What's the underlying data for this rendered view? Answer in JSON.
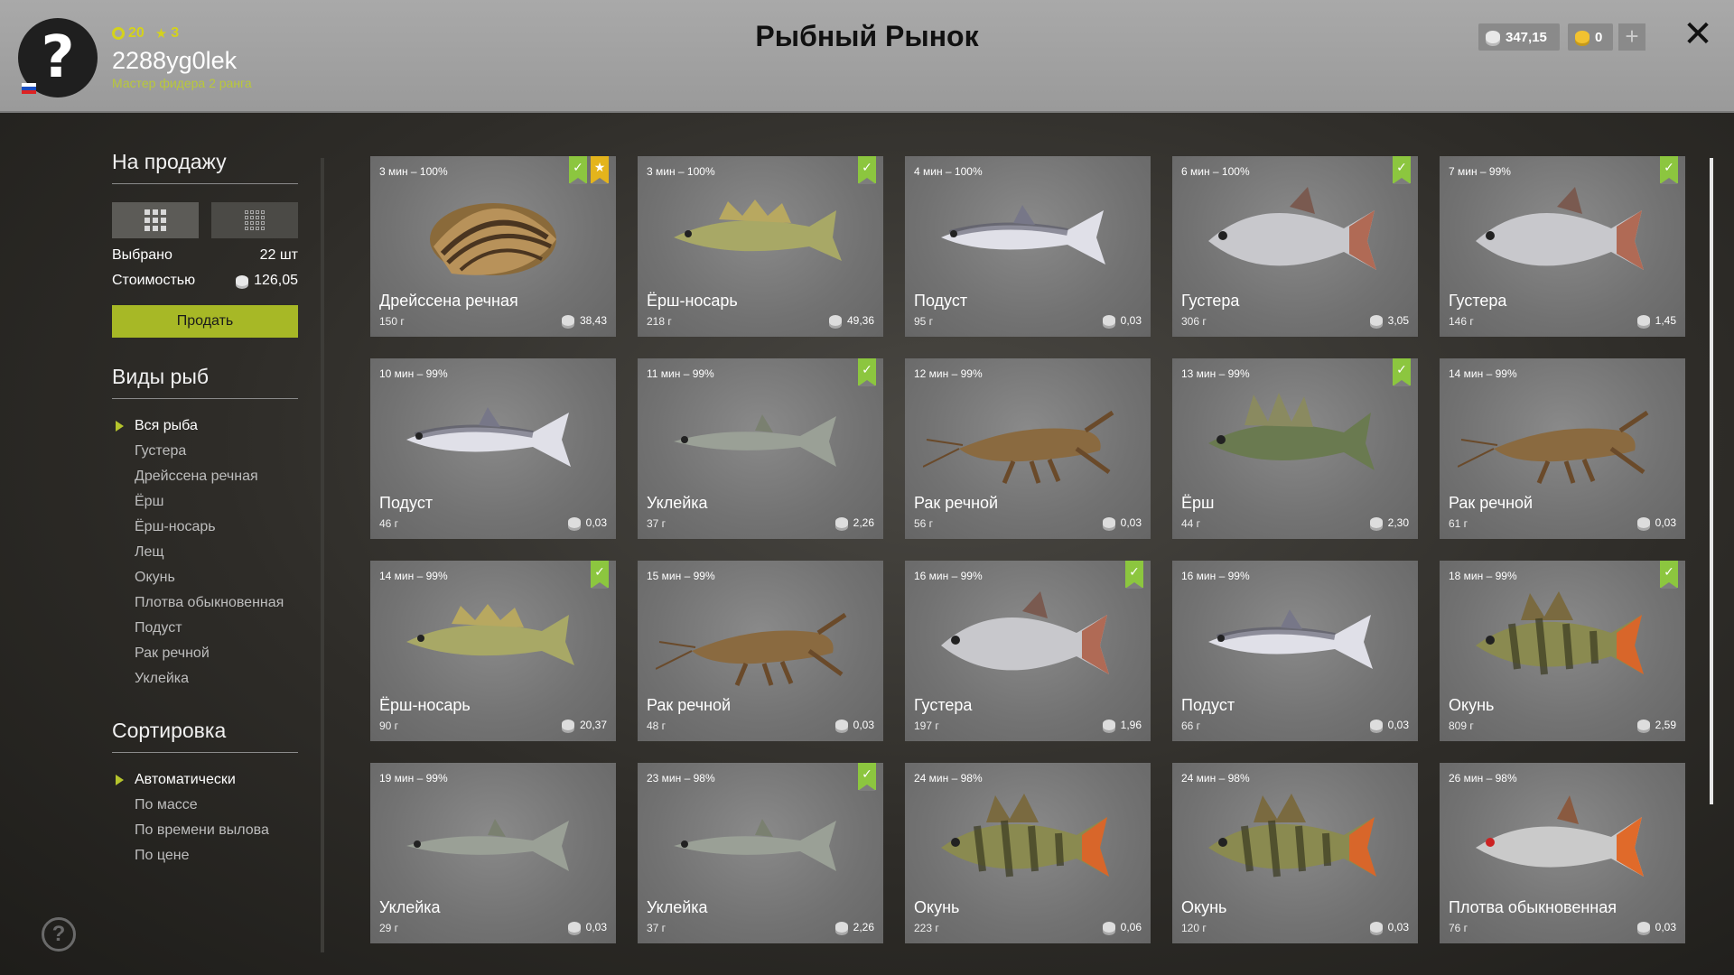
{
  "header": {
    "title": "Рыбный Рынок",
    "avatar_glyph": "?",
    "user": {
      "coins_small": "20",
      "stars": "3",
      "name": "2288yg0lek",
      "rank": "Мастер фидера 2 ранга"
    },
    "silver": "347,15",
    "gold": "0",
    "plus": "+",
    "close": "✕"
  },
  "sidebar": {
    "sale_title": "На продажу",
    "selected_label": "Выбрано",
    "selected_value": "22 шт",
    "cost_label": "Стоимостью",
    "cost_value": "126,05",
    "sell_button": "Продать",
    "species_title": "Виды рыб",
    "species": [
      "Вся рыба",
      "Густера",
      "Дрейссена речная",
      "Ёрш",
      "Ёрш-носарь",
      "Лещ",
      "Окунь",
      "Плотва обыкновенная",
      "Подуст",
      "Рак речной",
      "Уклейка"
    ],
    "sort_title": "Сортировка",
    "sort": [
      "Автоматически",
      "По массе",
      "По времени вылова",
      "По цене"
    ],
    "help": "?"
  },
  "cards": [
    {
      "time": "3 мин – 100%",
      "name": "Дрейссена речная",
      "weight": "150 г",
      "price": "38,43",
      "kind": "mussel",
      "check": true,
      "star": true
    },
    {
      "time": "3 мин – 100%",
      "name": "Ёрш-носарь",
      "weight": "218 г",
      "price": "49,36",
      "kind": "ruffe2",
      "check": true,
      "star": false
    },
    {
      "time": "4 мин – 100%",
      "name": "Подуст",
      "weight": "95 г",
      "price": "0,03",
      "kind": "podust",
      "check": false,
      "star": false
    },
    {
      "time": "6 мин – 100%",
      "name": "Густера",
      "weight": "306 г",
      "price": "3,05",
      "kind": "bream",
      "check": true,
      "star": false
    },
    {
      "time": "7 мин – 99%",
      "name": "Густера",
      "weight": "146 г",
      "price": "1,45",
      "kind": "bream",
      "check": true,
      "star": false
    },
    {
      "time": "10 мин – 99%",
      "name": "Подуст",
      "weight": "46 г",
      "price": "0,03",
      "kind": "podust",
      "check": false,
      "star": false
    },
    {
      "time": "11 мин – 99%",
      "name": "Уклейка",
      "weight": "37 г",
      "price": "2,26",
      "kind": "bleak",
      "check": true,
      "star": false
    },
    {
      "time": "12 мин – 99%",
      "name": "Рак речной",
      "weight": "56 г",
      "price": "0,03",
      "kind": "crayfish",
      "check": false,
      "star": false
    },
    {
      "time": "13 мин – 99%",
      "name": "Ёрш",
      "weight": "44 г",
      "price": "2,30",
      "kind": "ruffe",
      "check": true,
      "star": false
    },
    {
      "time": "14 мин – 99%",
      "name": "Рак речной",
      "weight": "61 г",
      "price": "0,03",
      "kind": "crayfish",
      "check": false,
      "star": false
    },
    {
      "time": "14 мин – 99%",
      "name": "Ёрш-носарь",
      "weight": "90 г",
      "price": "20,37",
      "kind": "ruffe2",
      "check": true,
      "star": false
    },
    {
      "time": "15 мин – 99%",
      "name": "Рак речной",
      "weight": "48 г",
      "price": "0,03",
      "kind": "crayfish",
      "check": false,
      "star": false
    },
    {
      "time": "16 мин – 99%",
      "name": "Густера",
      "weight": "197 г",
      "price": "1,96",
      "kind": "bream",
      "check": true,
      "star": false
    },
    {
      "time": "16 мин – 99%",
      "name": "Подуст",
      "weight": "66 г",
      "price": "0,03",
      "kind": "podust",
      "check": false,
      "star": false
    },
    {
      "time": "18 мин – 99%",
      "name": "Окунь",
      "weight": "809 г",
      "price": "2,59",
      "kind": "perch",
      "check": true,
      "star": false
    },
    {
      "time": "19 мин – 99%",
      "name": "Уклейка",
      "weight": "29 г",
      "price": "0,03",
      "kind": "bleak",
      "check": false,
      "star": false
    },
    {
      "time": "23 мин – 98%",
      "name": "Уклейка",
      "weight": "37 г",
      "price": "2,26",
      "kind": "bleak",
      "check": true,
      "star": false
    },
    {
      "time": "24 мин – 98%",
      "name": "Окунь",
      "weight": "223 г",
      "price": "0,06",
      "kind": "perch",
      "check": false,
      "star": false
    },
    {
      "time": "24 мин – 98%",
      "name": "Окунь",
      "weight": "120 г",
      "price": "0,03",
      "kind": "perch",
      "check": false,
      "star": false
    },
    {
      "time": "26 мин – 98%",
      "name": "Плотва обыкновенная",
      "weight": "76 г",
      "price": "0,03",
      "kind": "roach",
      "check": false,
      "star": false
    }
  ],
  "colors": {
    "accent": "#a7b826",
    "check_badge": "#8cc63f",
    "star_badge": "#e4b41c"
  }
}
